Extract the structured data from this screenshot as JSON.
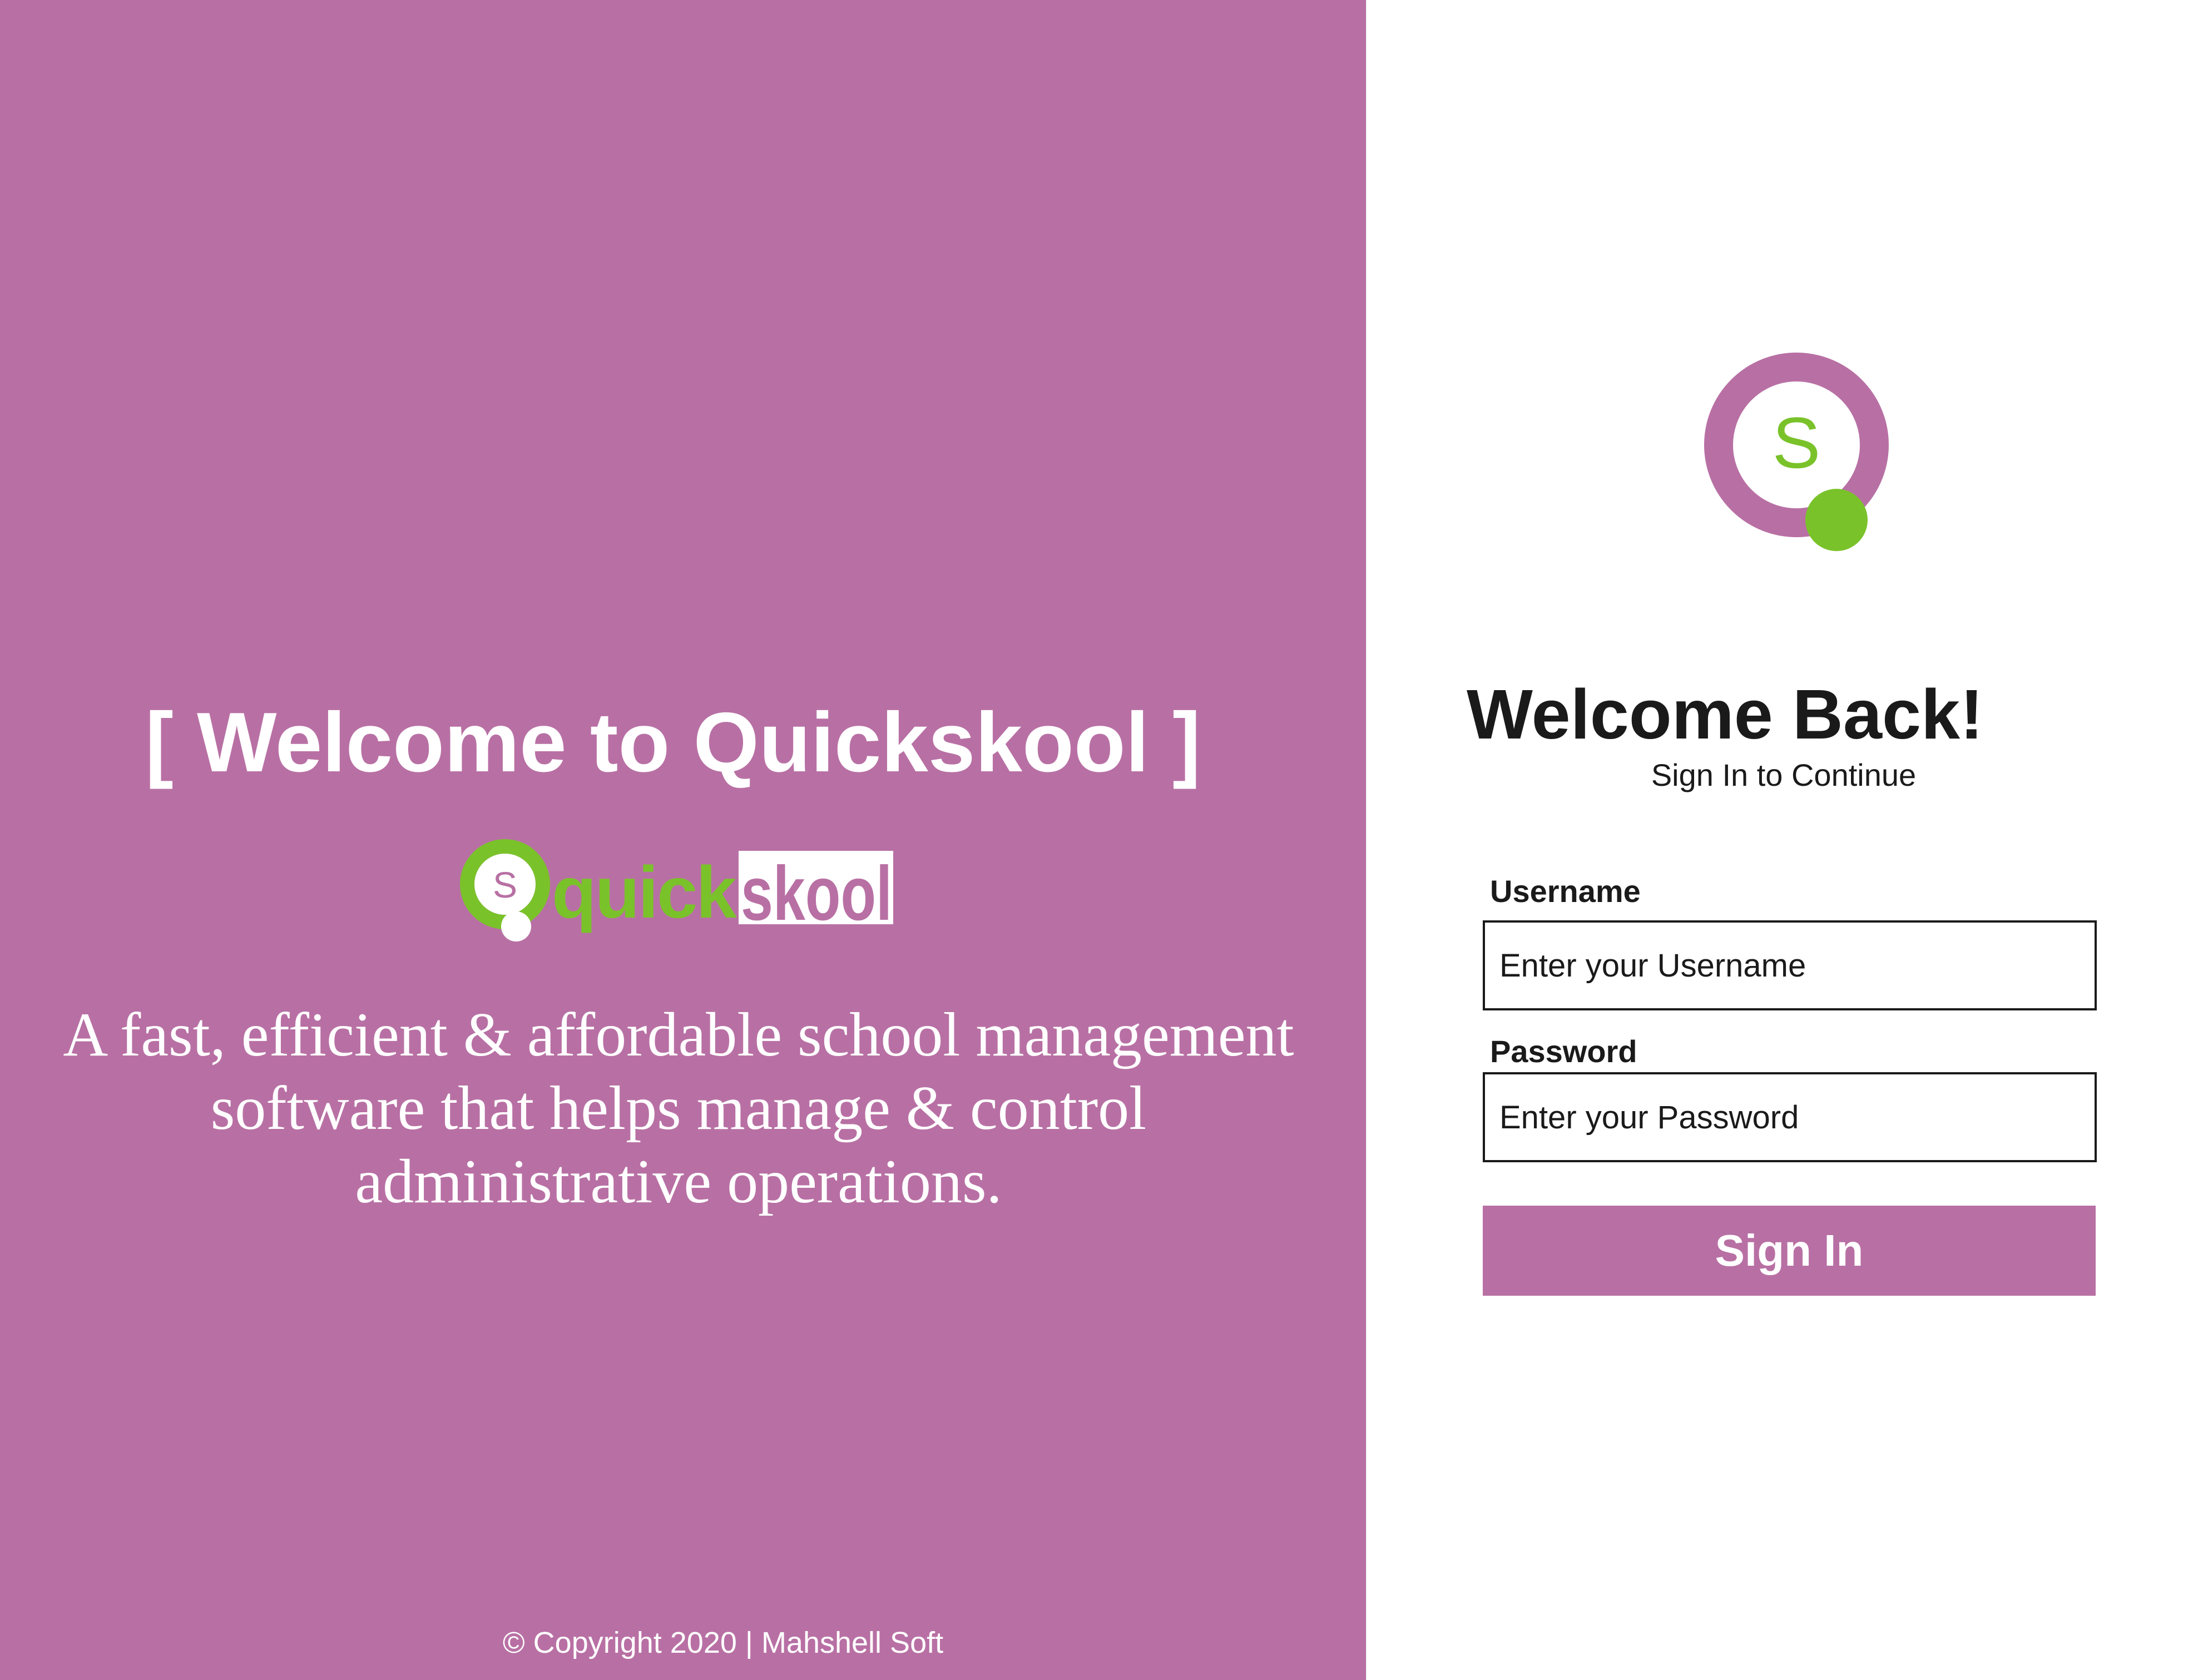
{
  "colors": {
    "brand_purple": "#b870a4",
    "brand_green": "#7ac22a",
    "text_dark": "#1a1a1a",
    "white": "#ffffff"
  },
  "left_panel": {
    "title": "[ Welcome to Quickskool ]",
    "logo": {
      "mark_letter": "S",
      "word_part_1": "quick",
      "word_part_2": "skool"
    },
    "tagline": "A fast, efficient & affordable school management software that helps manage & control administrative operations.",
    "copyright": "© Copyright 2020 | Mahshell Soft"
  },
  "login": {
    "mark_letter": "S",
    "heading": "Welcome Back!",
    "subheading": "Sign In to Continue",
    "username": {
      "label": "Username",
      "placeholder": "Enter your Username",
      "value": ""
    },
    "password": {
      "label": "Password",
      "placeholder": "Enter your Password",
      "value": ""
    },
    "submit_label": "Sign In"
  }
}
